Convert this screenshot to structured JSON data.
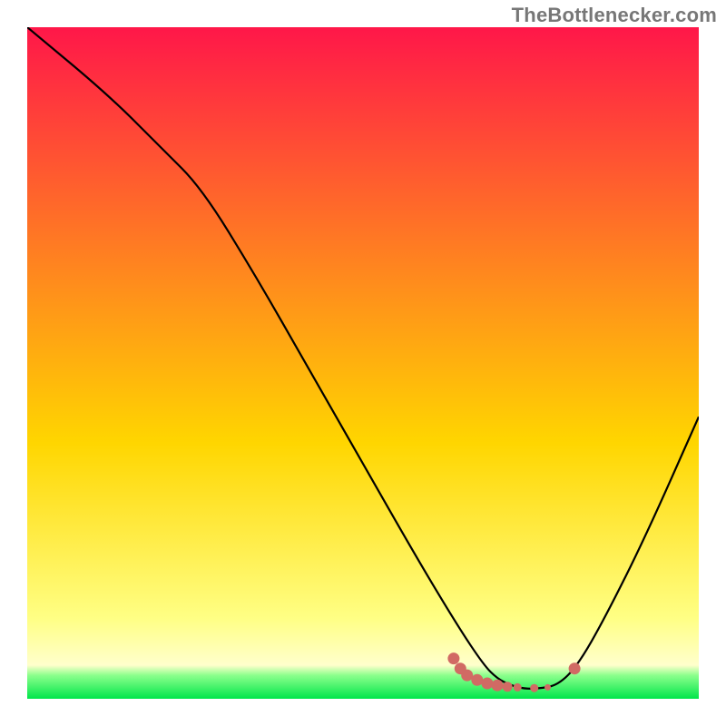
{
  "watermark": "TheBottlenecker.com",
  "colors": {
    "grad_top": "#ff1749",
    "grad_mid": "#ffd600",
    "grad_yellow": "#ffff84",
    "grad_green": "#00e64a",
    "line": "#000000",
    "marker_fill": "#d16a64",
    "marker_stroke": "#d16a64"
  },
  "chart_data": {
    "type": "line",
    "title": "",
    "xlabel": "",
    "ylabel": "",
    "xlim": [
      0,
      100
    ],
    "ylim": [
      0,
      100
    ],
    "series": [
      {
        "name": "curve",
        "x": [
          0,
          12,
          20,
          26,
          34,
          42,
          50,
          58,
          64,
          68,
          70,
          72,
          74,
          76,
          79,
          82,
          86,
          92,
          100
        ],
        "y": [
          100,
          90,
          82,
          76,
          63,
          49,
          35,
          21,
          11,
          5,
          3,
          2,
          1.5,
          1.5,
          2,
          5,
          12,
          24,
          42
        ]
      }
    ],
    "markers": {
      "name": "highlight",
      "points": [
        {
          "x": 63.5,
          "y": 6.0,
          "r": 6
        },
        {
          "x": 64.5,
          "y": 4.5,
          "r": 6
        },
        {
          "x": 65.5,
          "y": 3.5,
          "r": 6
        },
        {
          "x": 67.0,
          "y": 2.8,
          "r": 6
        },
        {
          "x": 68.5,
          "y": 2.3,
          "r": 6
        },
        {
          "x": 70.0,
          "y": 2.0,
          "r": 6
        },
        {
          "x": 71.5,
          "y": 1.8,
          "r": 5
        },
        {
          "x": 73.0,
          "y": 1.7,
          "r": 4
        },
        {
          "x": 75.5,
          "y": 1.6,
          "r": 4
        },
        {
          "x": 77.5,
          "y": 1.7,
          "r": 3
        },
        {
          "x": 81.5,
          "y": 4.5,
          "r": 6
        }
      ]
    },
    "gradient_stops": [
      0,
      0.62,
      0.88,
      0.95,
      0.965,
      1.0
    ]
  }
}
